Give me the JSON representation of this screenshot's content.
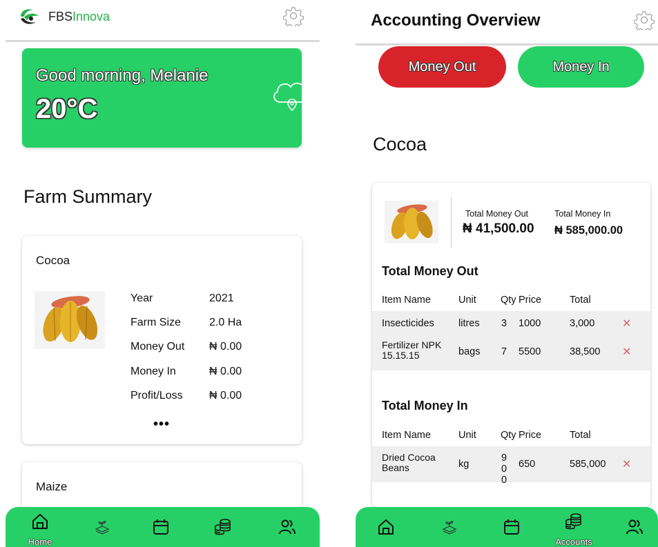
{
  "left": {
    "brand_prefix": "FBS",
    "brand_suffix": "Innova",
    "weather": {
      "greeting": "Good morning, Melanie",
      "temperature": "20°C"
    },
    "section_title": "Farm Summary",
    "cocoa_card": {
      "name": "Cocoa",
      "rows": [
        {
          "label": "Year",
          "value": "2021"
        },
        {
          "label": "Farm Size",
          "value": "2.0 Ha"
        },
        {
          "label": "Money Out",
          "value": "₦ 0.00"
        },
        {
          "label": "Money In",
          "value": "₦ 0.00"
        },
        {
          "label": "Profit/Loss",
          "value": "₦ 0.00"
        }
      ],
      "more": "•••"
    },
    "maize_card": {
      "name": "Maize"
    },
    "nav": {
      "home_label": "Home"
    }
  },
  "right": {
    "title": "Accounting Overview",
    "money_out_button": "Money Out",
    "money_in_button": "Money In",
    "crop_title": "Cocoa",
    "totals": {
      "out_label": "Total Money Out",
      "out_value": "₦ 41,500.00",
      "in_label": "Total Money In",
      "in_value": "₦ 585,000.00"
    },
    "money_out_section": {
      "title": "Total Money Out",
      "headers": [
        "Item Name",
        "Unit",
        "Qty",
        "Price",
        "Total"
      ],
      "rows": [
        {
          "item": "Insecticides",
          "unit": "litres",
          "qty": "3",
          "price": "1000",
          "total": "3,000"
        },
        {
          "item": "Fertilizer NPK 15.15.15",
          "unit": "bags",
          "qty": "7",
          "price": "5500",
          "total": "38,500"
        }
      ]
    },
    "money_in_section": {
      "title": "Total Money In",
      "headers": [
        "Item Name",
        "Unit",
        "Qty",
        "Price",
        "Total"
      ],
      "rows": [
        {
          "item": "Dried Cocoa Beans",
          "unit": "kg",
          "qty": "900",
          "price": "650",
          "total": "585,000"
        }
      ]
    },
    "delete_glyph": "✕",
    "nav": {
      "accounts_label": "Accounts"
    }
  },
  "colors": {
    "green": "#26d066",
    "red": "#d9232a",
    "brand_green": "#26b14b"
  },
  "icons": [
    "settings-gear-icon",
    "cloud-location-icon",
    "home-icon",
    "seedling-icon",
    "calendar-icon",
    "coins-icon",
    "users-icon",
    "delete-icon"
  ]
}
